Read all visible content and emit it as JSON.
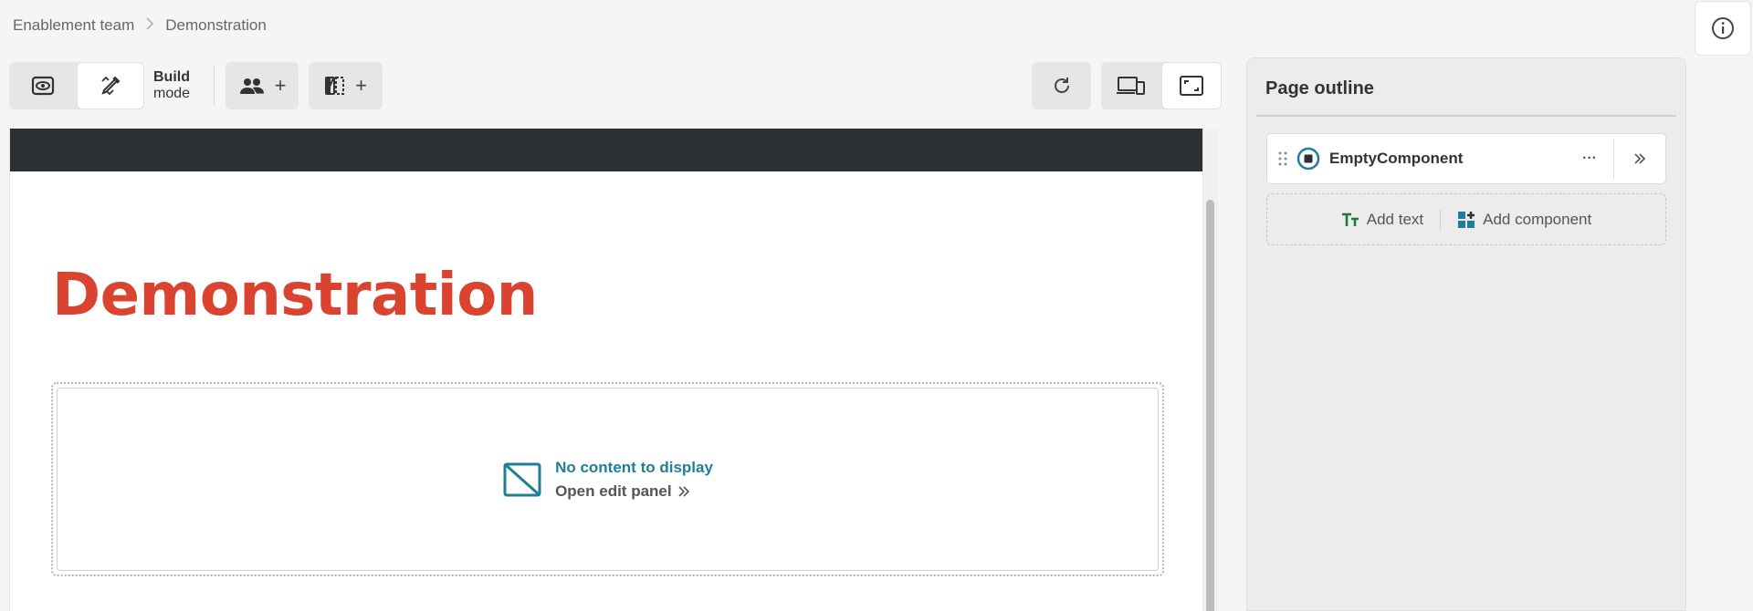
{
  "breadcrumb": {
    "items": [
      "Enablement team",
      "Demonstration"
    ]
  },
  "toolbar": {
    "build_label_1": "Build",
    "build_label_2": "mode",
    "plus": "+"
  },
  "canvas": {
    "title": "Demonstration",
    "empty": {
      "message": "No content to display",
      "action": "Open edit panel"
    }
  },
  "outline": {
    "title": "Page outline",
    "component_name": "EmptyComponent",
    "more": "···",
    "add_text": "Add text",
    "add_component": "Add component"
  },
  "colors": {
    "accent": "#1f7f99",
    "title_red": "#d9432f",
    "header_dark": "#2c3035",
    "add_text_green": "#1e7a43"
  }
}
